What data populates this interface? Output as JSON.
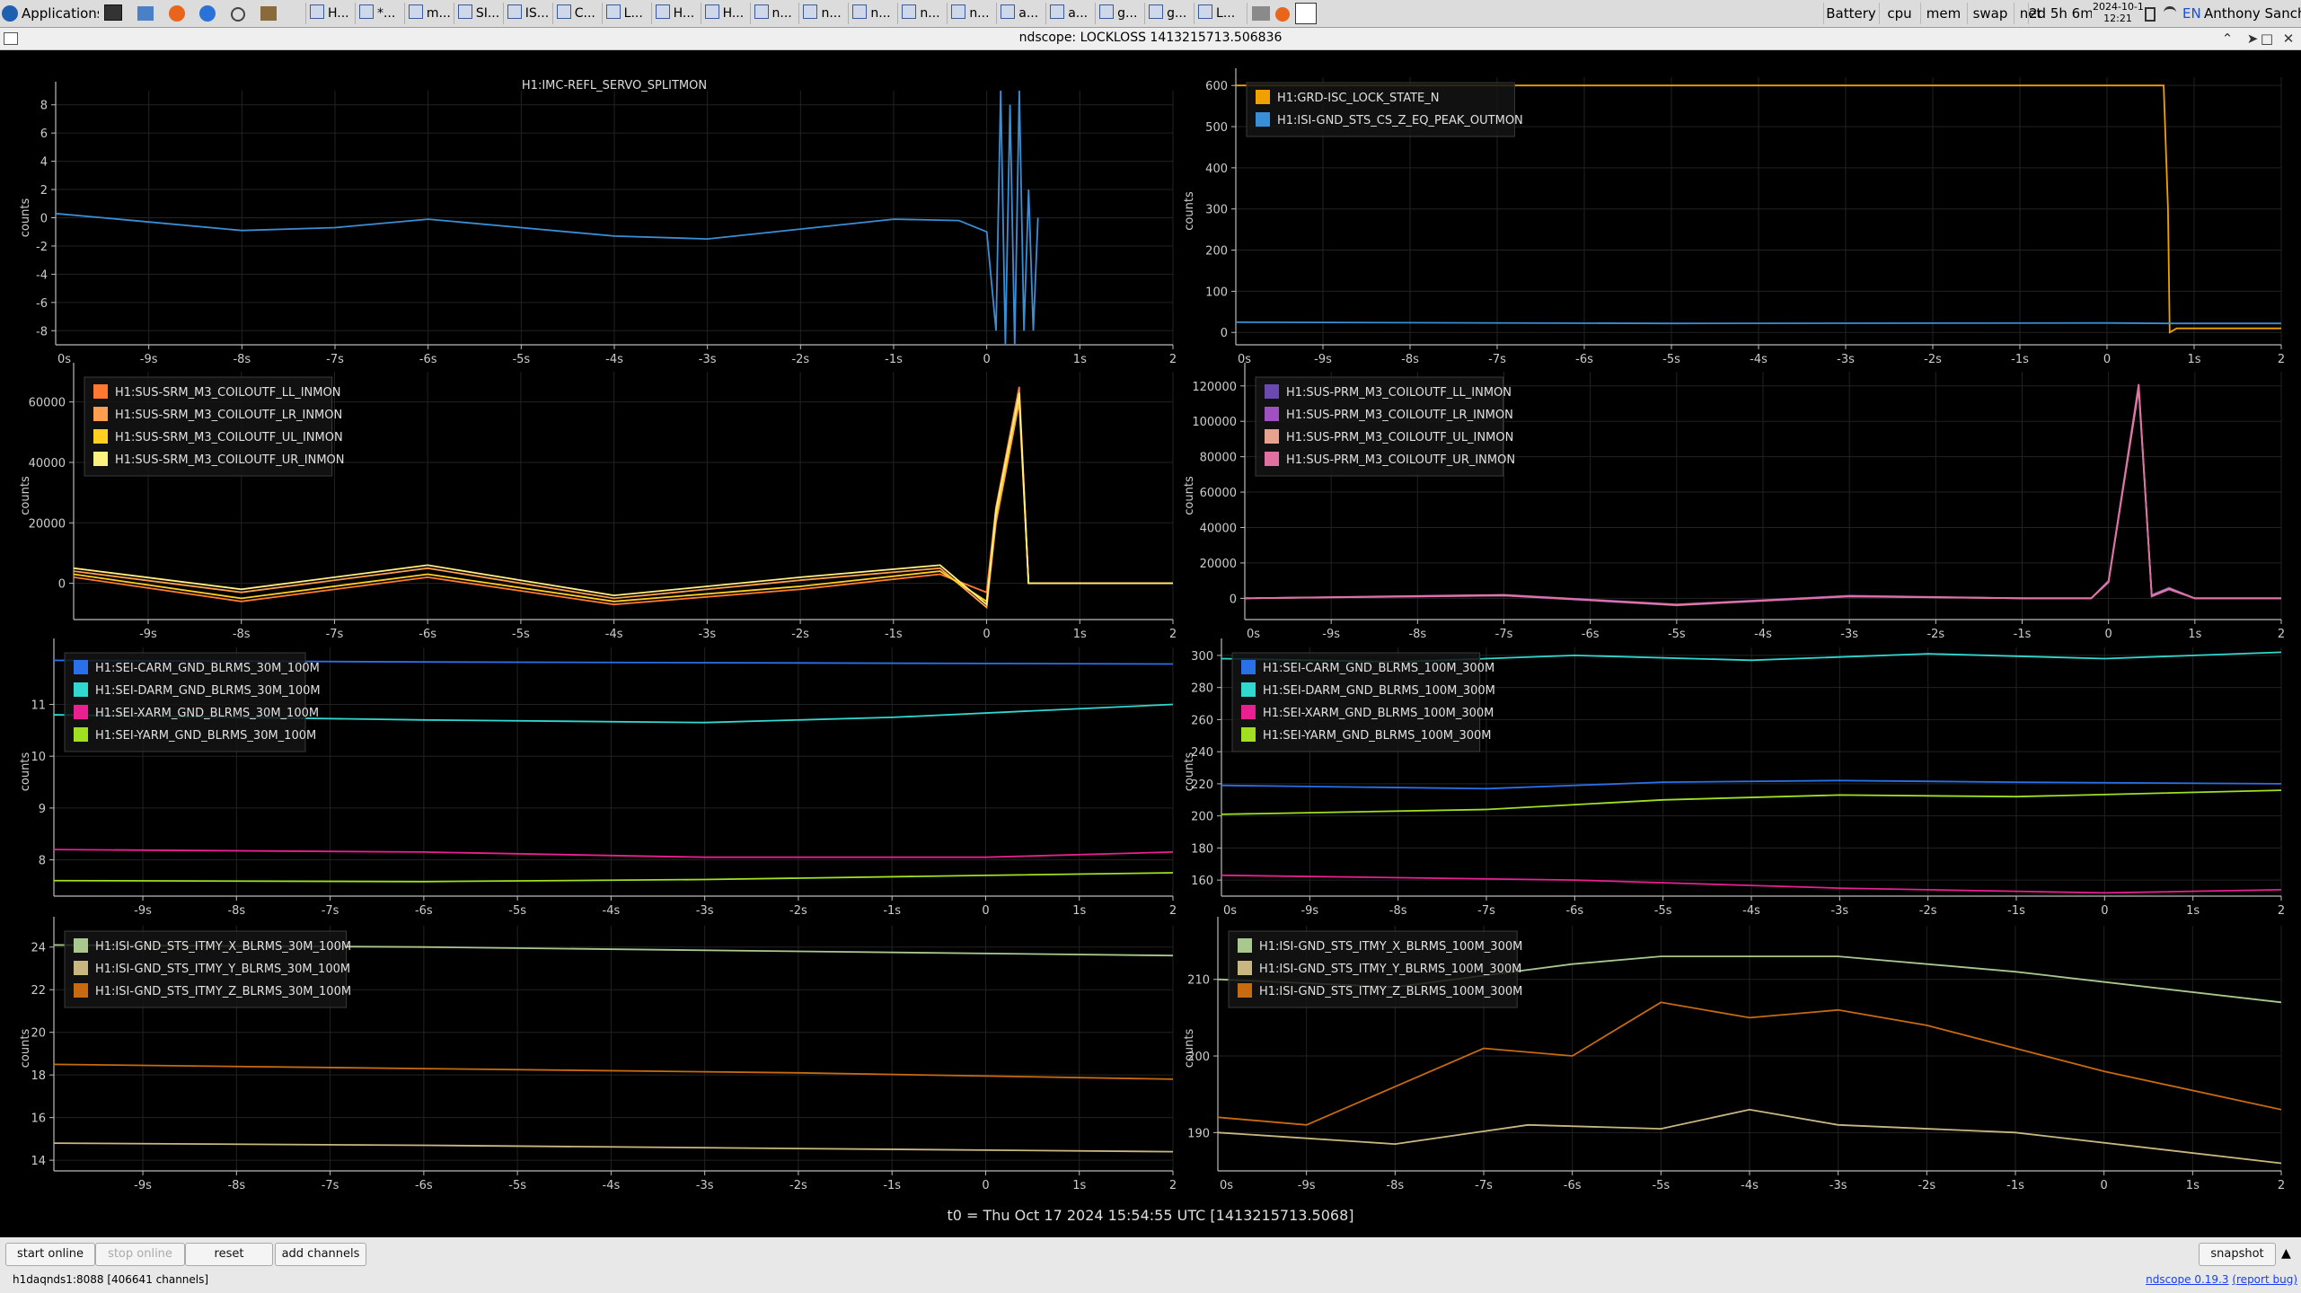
{
  "taskbar": {
    "apps_label": "Applications",
    "tasks": [
      "H...",
      "*...",
      "m...",
      "SI...",
      "IS...",
      "C...",
      "L...",
      "H...",
      "H...",
      "n...",
      "n...",
      "n...",
      "n...",
      "n...",
      "a...",
      "a...",
      "g...",
      "g...",
      "L..."
    ],
    "indicators": [
      "Battery",
      "cpu",
      "mem",
      "swap",
      "net"
    ],
    "uptime": "2d 5h 6m",
    "date": "2024-10-17",
    "time": "12:21",
    "lang": "EN",
    "user": "Anthony Sanchez"
  },
  "window": {
    "title": "ndscope: LOCKLOSS 1413215713.506836"
  },
  "t0_label": "t0 = Thu Oct 17 2024 15:54:55 UTC [1413215713.5068]",
  "buttons": {
    "start": "start online",
    "stop": "stop online",
    "reset": "reset",
    "add": "add channels",
    "snapshot": "snapshot"
  },
  "status": "h1daqnds1:8088  [406641 channels]",
  "version": {
    "name": "ndscope 0.19.3",
    "report": "(report bug)"
  },
  "axes": {
    "ylabel": "counts",
    "x_ticks": [
      -9,
      -8,
      -7,
      -6,
      -5,
      -4,
      -3,
      -2,
      -1,
      0,
      1,
      2
    ],
    "x_tick_labels": [
      "-9s",
      "-8s",
      "-7s",
      "-6s",
      "-5s",
      "-4s",
      "-3s",
      "-2s",
      "-1s",
      "0",
      "1s",
      "2"
    ],
    "x_edge_label": "0s"
  },
  "chart_data": [
    {
      "type": "line",
      "title": "H1:IMC-REFL_SERVO_SPLITMON",
      "ylabel": "counts",
      "xlim": [
        -10,
        2
      ],
      "ylim": [
        -9,
        9
      ],
      "yticks": [
        8,
        6,
        4,
        2,
        0,
        -2,
        -4,
        -6,
        -8
      ],
      "ytick_labels": [
        "8",
        "6",
        "4",
        "2",
        "0",
        "-2",
        "-4",
        "-6",
        "-8"
      ],
      "show_x_edge": true,
      "series": [
        {
          "name": "H1:IMC-REFL_SERVO_SPLITMON",
          "color": "#3a8ed6",
          "show_legend": false,
          "x": [
            -10,
            -9,
            -8,
            -7,
            -6,
            -5,
            -4,
            -3,
            -2,
            -1,
            -0.3,
            0,
            0.1,
            0.15,
            0.2,
            0.25,
            0.3,
            0.35,
            0.4,
            0.45,
            0.5,
            0.55
          ],
          "y": [
            0.3,
            -0.3,
            -0.9,
            -0.7,
            -0.1,
            -0.7,
            -1.3,
            -1.5,
            -0.8,
            -0.1,
            -0.2,
            -1,
            -8,
            9,
            -9,
            8,
            -9,
            9,
            -8,
            2,
            -8,
            0
          ]
        }
      ]
    },
    {
      "type": "line",
      "title": "",
      "ylabel": "counts",
      "xlim": [
        -10,
        2
      ],
      "ylim": [
        -30,
        620
      ],
      "yticks": [
        600,
        500,
        400,
        300,
        200,
        100,
        0
      ],
      "ytick_labels": [
        "600",
        "500",
        "400",
        "300",
        "200",
        "100",
        "0"
      ],
      "show_x_edge": true,
      "series": [
        {
          "name": "H1:GRD-ISC_LOCK_STATE_N",
          "color": "#f0a000",
          "x": [
            -10,
            0.65,
            0.7,
            0.72,
            0.8,
            2
          ],
          "y": [
            600,
            600,
            300,
            0,
            10,
            10
          ]
        },
        {
          "name": "H1:ISI-GND_STS_CS_Z_EQ_PEAK_OUTMON",
          "color": "#3a8ed6",
          "x": [
            -10,
            -5,
            0,
            0.7,
            2
          ],
          "y": [
            25,
            22,
            23,
            22,
            22
          ]
        }
      ]
    },
    {
      "type": "line",
      "title": "",
      "ylabel": "counts",
      "xlim": [
        -9.8,
        2
      ],
      "ylim": [
        -12000,
        70000
      ],
      "yticks": [
        60000,
        40000,
        20000,
        0
      ],
      "ytick_labels": [
        "60000",
        "40000",
        "20000",
        "0"
      ],
      "show_x_edge": false,
      "series": [
        {
          "name": "H1:SUS-SRM_M3_COILOUTF_LL_INMON",
          "color": "#ff7a30",
          "x": [
            -9.8,
            -8,
            -6,
            -4,
            -2,
            -0.5,
            0,
            0.1,
            0.35,
            0.45,
            2
          ],
          "y": [
            2000,
            -6000,
            2000,
            -7000,
            -2000,
            3000,
            -3000,
            25000,
            65000,
            0,
            0
          ]
        },
        {
          "name": "H1:SUS-SRM_M3_COILOUTF_LR_INMON",
          "color": "#ff9e50",
          "x": [
            -9.8,
            -8,
            -6,
            -4,
            -2,
            -0.5,
            0,
            0.1,
            0.35,
            0.45,
            2
          ],
          "y": [
            4000,
            -3000,
            5000,
            -5000,
            1000,
            5000,
            -8000,
            20000,
            60000,
            0,
            0
          ]
        },
        {
          "name": "H1:SUS-SRM_M3_COILOUTF_UL_INMON",
          "color": "#ffd020",
          "x": [
            -9.8,
            -8,
            -6,
            -4,
            -2,
            -0.5,
            0,
            0.1,
            0.35,
            0.45,
            2
          ],
          "y": [
            3000,
            -5000,
            3000,
            -6000,
            -1000,
            4000,
            -6000,
            22000,
            62000,
            0,
            0
          ]
        },
        {
          "name": "H1:SUS-SRM_M3_COILOUTF_UR_INMON",
          "color": "#fff080",
          "x": [
            -9.8,
            -8,
            -6,
            -4,
            -2,
            -0.5,
            0,
            0.1,
            0.35,
            0.45,
            2
          ],
          "y": [
            5000,
            -2000,
            6000,
            -4000,
            2000,
            6000,
            -7000,
            24000,
            63000,
            0,
            0
          ]
        }
      ]
    },
    {
      "type": "line",
      "title": "",
      "ylabel": "counts",
      "xlim": [
        -10,
        2
      ],
      "ylim": [
        -12000,
        128000
      ],
      "yticks": [
        120000,
        100000,
        80000,
        60000,
        40000,
        20000,
        0
      ],
      "ytick_labels": [
        "120000",
        "100000",
        "80000",
        "60000",
        "40000",
        "20000",
        "0"
      ],
      "show_x_edge": true,
      "series": [
        {
          "name": "H1:SUS-PRM_M3_COILOUTF_LL_INMON",
          "color": "#6a4ab0",
          "x": [
            -10,
            -7,
            -5,
            -3,
            -1,
            -0.2,
            0,
            0.35,
            0.5,
            0.7,
            1,
            2
          ],
          "y": [
            0,
            1500,
            -4000,
            1000,
            0,
            0,
            10000,
            120000,
            2000,
            6000,
            0,
            0
          ]
        },
        {
          "name": "H1:SUS-PRM_M3_COILOUTF_LR_INMON",
          "color": "#a050c0",
          "x": [
            -10,
            -7,
            -5,
            -3,
            -1,
            -0.2,
            0,
            0.35,
            0.5,
            0.7,
            1,
            2
          ],
          "y": [
            0,
            2000,
            -3500,
            1500,
            0,
            0,
            9000,
            118000,
            1000,
            5000,
            0,
            0
          ]
        },
        {
          "name": "H1:SUS-PRM_M3_COILOUTF_UL_INMON",
          "color": "#e8a090",
          "x": [
            -10,
            -7,
            -5,
            -3,
            -1,
            -0.2,
            0,
            0.35,
            0.5,
            0.7,
            1,
            2
          ],
          "y": [
            0,
            1800,
            -3800,
            1200,
            0,
            0,
            9500,
            119000,
            1500,
            5500,
            0,
            0
          ]
        },
        {
          "name": "H1:SUS-PRM_M3_COILOUTF_UR_INMON",
          "color": "#e070a0",
          "x": [
            -10,
            -7,
            -5,
            -3,
            -1,
            -0.2,
            0,
            0.35,
            0.5,
            0.7,
            1,
            2
          ],
          "y": [
            0,
            1600,
            -3600,
            1100,
            0,
            0,
            9200,
            121000,
            1200,
            5200,
            0,
            0
          ]
        }
      ]
    },
    {
      "type": "line",
      "title": "",
      "ylabel": "counts",
      "xlim": [
        -9.95,
        2
      ],
      "ylim": [
        7.3,
        12.1
      ],
      "yticks": [
        11,
        10,
        9,
        8
      ],
      "ytick_labels": [
        "11",
        "10",
        "9",
        "8"
      ],
      "show_x_edge": false,
      "series": [
        {
          "name": "H1:SEI-CARM_GND_BLRMS_30M_100M",
          "color": "#2a70e8",
          "x": [
            -10,
            -6,
            -2,
            2
          ],
          "y": [
            11.85,
            11.82,
            11.8,
            11.78
          ]
        },
        {
          "name": "H1:SEI-DARM_GND_BLRMS_30M_100M",
          "color": "#30d8d0",
          "x": [
            -10,
            -6,
            -3,
            -1,
            2
          ],
          "y": [
            10.8,
            10.7,
            10.65,
            10.75,
            11
          ]
        },
        {
          "name": "H1:SEI-XARM_GND_BLRMS_30M_100M",
          "color": "#e82090",
          "x": [
            -10,
            -6,
            -3,
            0,
            2
          ],
          "y": [
            8.2,
            8.15,
            8.05,
            8.05,
            8.15
          ]
        },
        {
          "name": "H1:SEI-YARM_GND_BLRMS_30M_100M",
          "color": "#a0e020",
          "x": [
            -10,
            -6,
            -3,
            0,
            2
          ],
          "y": [
            7.6,
            7.58,
            7.62,
            7.7,
            7.75
          ]
        }
      ]
    },
    {
      "type": "line",
      "title": "",
      "ylabel": "counts",
      "xlim": [
        -10,
        2
      ],
      "ylim": [
        150,
        305
      ],
      "yticks": [
        300,
        280,
        260,
        240,
        220,
        200,
        180,
        160
      ],
      "ytick_labels": [
        "300",
        "280",
        "260",
        "240",
        "220",
        "200",
        "180",
        "160"
      ],
      "show_x_edge": true,
      "series": [
        {
          "name": "H1:SEI-CARM_GND_BLRMS_100M_300M",
          "color": "#2a70e8",
          "x": [
            -10,
            -7,
            -5,
            -3,
            -1,
            2
          ],
          "y": [
            219,
            217,
            221,
            222,
            221,
            220
          ]
        },
        {
          "name": "H1:SEI-DARM_GND_BLRMS_100M_300M",
          "color": "#30d8d0",
          "x": [
            -10,
            -8,
            -6,
            -4,
            -2,
            0,
            2
          ],
          "y": [
            298,
            296,
            300,
            297,
            301,
            298,
            302
          ]
        },
        {
          "name": "H1:SEI-XARM_GND_BLRMS_100M_300M",
          "color": "#e82090",
          "x": [
            -10,
            -6,
            -3,
            0,
            2
          ],
          "y": [
            163,
            160,
            155,
            152,
            154
          ]
        },
        {
          "name": "H1:SEI-YARM_GND_BLRMS_100M_300M",
          "color": "#a0e020",
          "x": [
            -10,
            -7,
            -5,
            -3,
            -1,
            2
          ],
          "y": [
            201,
            204,
            210,
            213,
            212,
            216
          ]
        }
      ]
    },
    {
      "type": "line",
      "title": "",
      "ylabel": "counts",
      "xlim": [
        -9.95,
        2
      ],
      "ylim": [
        13.5,
        25
      ],
      "yticks": [
        24,
        22,
        20,
        18,
        16,
        14
      ],
      "ytick_labels": [
        "24",
        "22",
        "20",
        "18",
        "16",
        "14"
      ],
      "show_x_edge": false,
      "series": [
        {
          "name": "H1:ISI-GND_STS_ITMY_X_BLRMS_30M_100M",
          "color": "#a8c890",
          "x": [
            -10,
            -6,
            -2,
            2
          ],
          "y": [
            24.1,
            24,
            23.8,
            23.6
          ]
        },
        {
          "name": "H1:ISI-GND_STS_ITMY_Y_BLRMS_30M_100M",
          "color": "#c8b880",
          "x": [
            -10,
            -6,
            -2,
            2
          ],
          "y": [
            14.8,
            14.7,
            14.55,
            14.4
          ]
        },
        {
          "name": "H1:ISI-GND_STS_ITMY_Z_BLRMS_30M_100M",
          "color": "#c86a10",
          "x": [
            -10,
            -6,
            -2,
            2
          ],
          "y": [
            18.5,
            18.3,
            18.1,
            17.8
          ]
        }
      ]
    },
    {
      "type": "line",
      "title": "",
      "ylabel": "counts",
      "xlim": [
        -10,
        2
      ],
      "ylim": [
        185,
        217
      ],
      "yticks": [
        210,
        200,
        190
      ],
      "ytick_labels": [
        "210",
        "200",
        "190"
      ],
      "show_x_edge": true,
      "series": [
        {
          "name": "H1:ISI-GND_STS_ITMY_X_BLRMS_100M_300M",
          "color": "#a8c890",
          "x": [
            -10,
            -8,
            -6,
            -5,
            -3,
            -1,
            2
          ],
          "y": [
            210,
            209,
            212,
            213,
            213,
            211,
            207
          ]
        },
        {
          "name": "H1:ISI-GND_STS_ITMY_Y_BLRMS_100M_300M",
          "color": "#c8b880",
          "x": [
            -10,
            -8,
            -6.5,
            -5,
            -4,
            -3,
            -1,
            2
          ],
          "y": [
            190,
            188.5,
            191,
            190.5,
            193,
            191,
            190,
            186
          ]
        },
        {
          "name": "H1:ISI-GND_STS_ITMY_Z_BLRMS_100M_300M",
          "color": "#c86a10",
          "x": [
            -10,
            -9,
            -8,
            -7,
            -6,
            -5,
            -4,
            -3,
            -2,
            -1,
            0,
            2
          ],
          "y": [
            192,
            191,
            196,
            201,
            200,
            207,
            205,
            206,
            204,
            201,
            198,
            193
          ]
        }
      ]
    }
  ]
}
